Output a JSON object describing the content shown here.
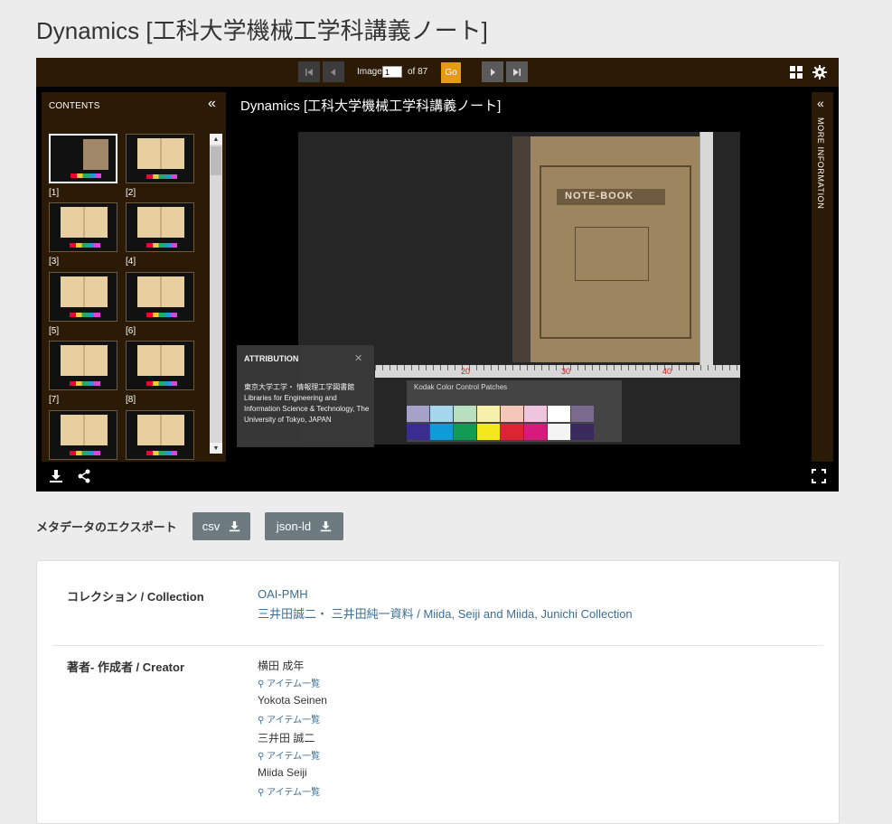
{
  "page": {
    "title": "Dynamics [工科大学機械工学科講義ノート]"
  },
  "toolbar": {
    "image_label": "Image",
    "current_page": "1",
    "of_total": "of 87",
    "go_label": "Go",
    "icons": [
      "first-page-icon",
      "prev-page-icon",
      "next-page-icon",
      "last-page-icon",
      "grid-icon",
      "gear-icon"
    ]
  },
  "contents": {
    "title": "CONTENTS",
    "thumbnails": [
      {
        "label": "[1]",
        "selected": true
      },
      {
        "label": "[2]"
      },
      {
        "label": "[3]"
      },
      {
        "label": "[4]"
      },
      {
        "label": "[5]"
      },
      {
        "label": "[6]"
      },
      {
        "label": "[7]"
      },
      {
        "label": "[8]"
      },
      {
        "label": ""
      },
      {
        "label": ""
      }
    ]
  },
  "viewer": {
    "image_title": "Dynamics [工科大学機械工学科講義ノート]",
    "attribution": {
      "title": "ATTRIBUTION",
      "text": "東京大学工学・ 情報理工学図書館 Libraries for Engineering and Information Science & Technology, The University of Tokyo, JAPAN"
    },
    "more_information": "MORE INFORMATION",
    "book_cover_text": "NOTE-BOOK",
    "ruler_labels": [
      "20",
      "30",
      "40"
    ],
    "color_card_label": "Kodak Color Control Patches"
  },
  "export": {
    "label": "メタデータのエクスポート",
    "buttons": [
      {
        "label": "csv"
      },
      {
        "label": "json-ld"
      }
    ]
  },
  "metadata": {
    "collection": {
      "key": "コレクション / Collection",
      "values": [
        "OAI-PMH",
        "三井田誠二・ 三井田純一資料 / Miida, Seiji and Miida, Junichi Collection"
      ]
    },
    "creator": {
      "key": "著者‐ 作成者 / Creator",
      "values": [
        "横田 成年",
        "Yokota Seinen",
        "三井田 誠二",
        "Miida Seiji"
      ],
      "search_label": "アイテム一覧"
    }
  },
  "colors": {
    "toolbar_bg": "#2b1a06",
    "go_button": "#e79a14",
    "link": "#3c6e96",
    "export_button": "#6d7a80"
  }
}
